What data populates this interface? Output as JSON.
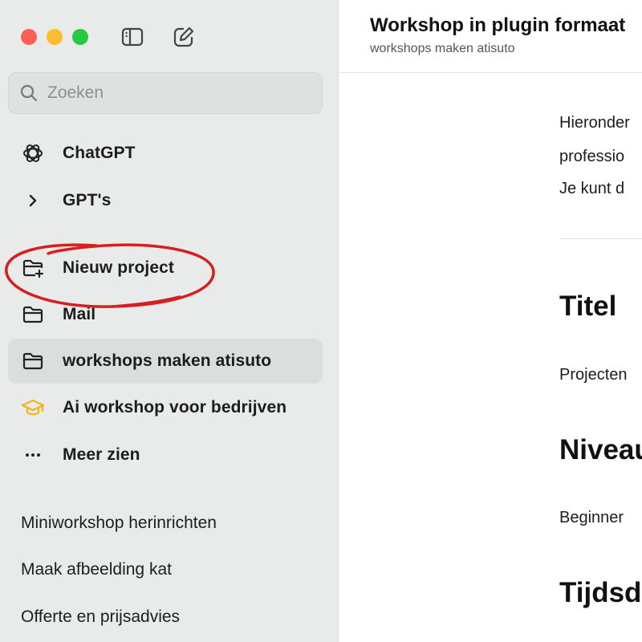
{
  "sidebar": {
    "search_placeholder": "Zoeken",
    "nav": [
      {
        "label": "ChatGPT",
        "icon": "openai-logo-icon"
      },
      {
        "label": "GPT's",
        "icon": "chevron-right-icon"
      },
      {
        "label": "Nieuw project",
        "icon": "folder-plus-icon",
        "annotated": true
      },
      {
        "label": "Mail",
        "icon": "folder-icon"
      },
      {
        "label": "workshops maken atisuto",
        "icon": "folder-icon",
        "active": true
      },
      {
        "label": "Ai workshop voor bedrijven",
        "icon": "graduation-cap-icon"
      },
      {
        "label": "Meer zien",
        "icon": "more-dots-icon"
      }
    ],
    "recent": [
      "Miniworkshop herinrichten",
      "Maak afbeelding kat",
      "Offerte en prijsadvies"
    ]
  },
  "header": {
    "title": "Workshop in plugin formaat",
    "subtitle": "workshops maken atisuto"
  },
  "content": {
    "intro_lines": [
      "Hieronder",
      "professio",
      "Je kunt d"
    ],
    "sections": [
      {
        "heading": "Titel",
        "text": "Projecten"
      },
      {
        "heading": "Niveau",
        "text": "Beginner"
      },
      {
        "heading": "Tijdsd",
        "text": ""
      }
    ]
  },
  "colors": {
    "sidebar_bg": "#e9ebea",
    "annotation_red": "#d61f1f",
    "cap_yellow": "#f2b21b"
  }
}
